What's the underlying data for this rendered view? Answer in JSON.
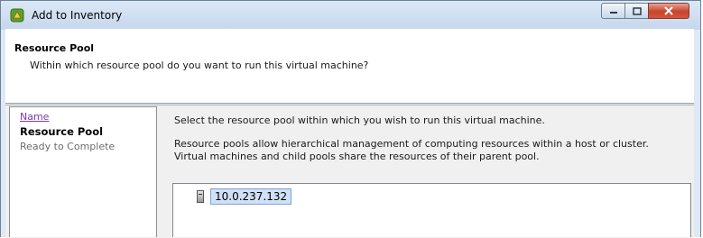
{
  "window": {
    "title": "Add to Inventory",
    "controls": {
      "minimize": "minimize",
      "maximize": "maximize",
      "close": "close"
    }
  },
  "header": {
    "title": "Resource Pool",
    "subtitle": "Within which resource pool do you want to run this virtual machine?"
  },
  "steps": [
    {
      "label": "Name",
      "state": "link"
    },
    {
      "label": "Resource Pool",
      "state": "current"
    },
    {
      "label": "Ready to Complete",
      "state": "future"
    }
  ],
  "content": {
    "instruction": "Select the resource pool within which you wish to run this virtual machine.",
    "description": "Resource pools allow hierarchical management of computing resources within a host or cluster. Virtual machines and child pools share the resources of their parent pool."
  },
  "tree": {
    "items": [
      {
        "label": "10.0.237.132",
        "icon": "host-icon",
        "selected": true
      }
    ]
  },
  "colors": {
    "link": "#7d39b3",
    "selection_bg": "#cfe0f7",
    "window_frame": "#dfe9f5"
  }
}
